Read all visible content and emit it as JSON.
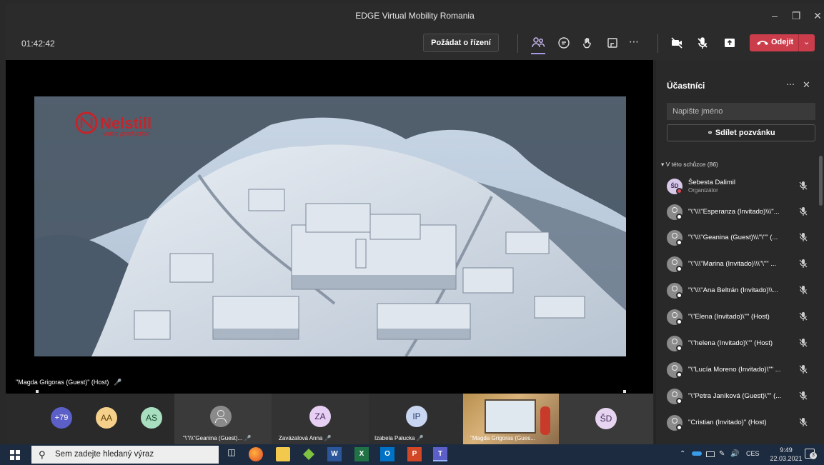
{
  "window": {
    "title": "EDGE Virtual Mobility Romania"
  },
  "meeting": {
    "timer": "01:42:42",
    "request_control": "Požádat o řízení",
    "leave_label": "Odejít"
  },
  "stage": {
    "speaker_label": "\"Magda Grigoras (Guest)\" (Host)",
    "video_brand": "Nelstill",
    "video_brand_sub": "video production"
  },
  "panel": {
    "title": "Účastníci",
    "search_placeholder": "Napište jméno",
    "share_label": "Sdílet pozvánku",
    "section_label": "V této schůzce (86)",
    "organizer": {
      "initials": "ŠD",
      "name": "Šebesta Dalimil",
      "role": "Organizátor"
    },
    "participants": [
      "\"\\\"\\\\\\\"Esperanza (Invitado)\\\\\\\"...",
      "\"\\\"\\\\\\\"Geanina (Guest)\\\\\\\"\\\"\" (...",
      "\"\\\"\\\\\\\"Marina (Invitado)\\\\\\\"\\\"\" ...",
      "\"\\\"\\\\\\\"Ana Beltrán (Invitado)\\\\...",
      "\"\\\"Elena (Invitado)\\\"\" (Host)",
      "\"\\\"helena (Invitado)\\\"\" (Host)",
      "\"\\\"Lucía Moreno (Invitado)\\\"\" ...",
      "\"\\\"Petra Janíková (Guest)\\\"\" (...",
      "\"Cristian (Invitado)\" (Host)"
    ]
  },
  "gallery": {
    "overflow_count": "+79",
    "avatars": [
      {
        "initials": "AA",
        "color": "#f5d08a",
        "text_color": "#5a3e00"
      },
      {
        "initials": "AS",
        "color": "#a8dfc0",
        "text_color": "#17492f"
      }
    ],
    "tiles": [
      {
        "label": "\"\\\"\\\\\\\"Geanina (Guest)...",
        "kind": "icon"
      },
      {
        "label": "Zavázalová Anna",
        "initials": "ZA",
        "color": "#e6cff2",
        "text_color": "#4b2a5f"
      },
      {
        "label": "Izabela Pałucka",
        "initials": "IP",
        "color": "#c9d6f2",
        "text_color": "#233a6b"
      },
      {
        "label": "\"Magda Grigoras (Gues...",
        "kind": "video"
      },
      {
        "initials": "ŠD",
        "color": "#e6d4f0",
        "text_color": "#3d2a55"
      }
    ]
  },
  "taskbar": {
    "search_placeholder": "Sem zadejte hledaný výraz",
    "lang": "CES",
    "time": "9:49",
    "date": "22.03.2021",
    "notifications": "3"
  }
}
